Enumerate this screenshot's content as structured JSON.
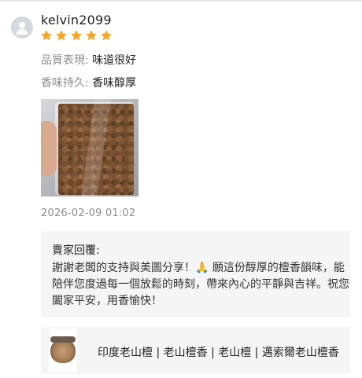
{
  "review": {
    "username": "kelvin2099",
    "rating": 5,
    "star_color": "#f6a623",
    "attributes": [
      {
        "key": "品質表現: ",
        "value": "味道很好"
      },
      {
        "key": "香味持久: ",
        "value": "香味醇厚"
      }
    ],
    "timestamp": "2026-02-09 01:02"
  },
  "seller_reply": {
    "title": "賣家回覆:",
    "text": "謝謝老闆的支持與美圖分享！🙏 願這份醇厚的檀香韻味，能陪伴您度過每一個放鬆的時刻，帶來內心的平靜與吉祥。祝您闔家平安，用香愉快！"
  },
  "product": {
    "name": "印度老山檀 | 老山檀香 | 老山檀 | 邁索爾老山檀香"
  }
}
